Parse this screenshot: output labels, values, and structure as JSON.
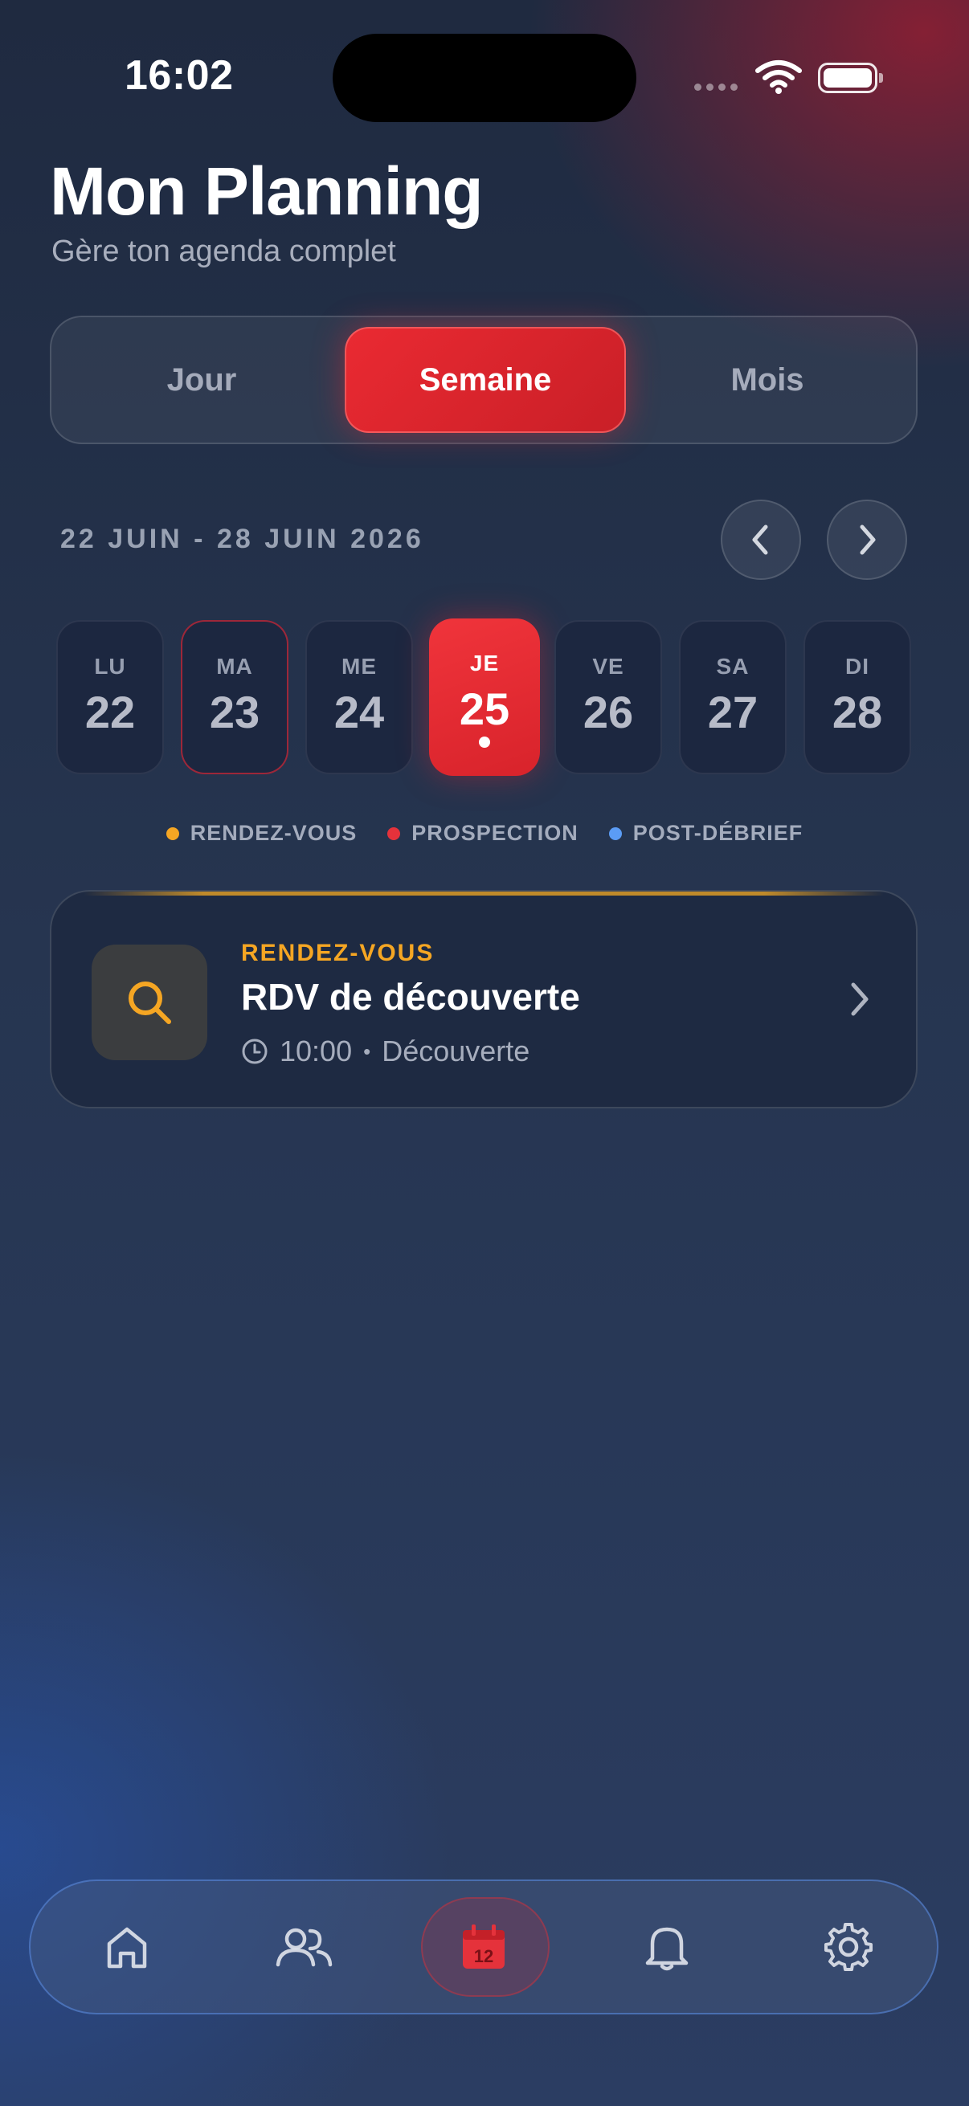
{
  "status_bar": {
    "time": "16:02"
  },
  "header": {
    "title": "Mon Planning",
    "subtitle": "Gère ton agenda complet"
  },
  "view_switch": {
    "options": [
      "Jour",
      "Semaine",
      "Mois"
    ],
    "selected": "Semaine"
  },
  "week": {
    "range_label": "22 JUIN - 28 JUIN 2026",
    "days": [
      {
        "name": "LU",
        "date": "22"
      },
      {
        "name": "MA",
        "date": "23"
      },
      {
        "name": "ME",
        "date": "24"
      },
      {
        "name": "JE",
        "date": "25"
      },
      {
        "name": "VE",
        "date": "26"
      },
      {
        "name": "SA",
        "date": "27"
      },
      {
        "name": "DI",
        "date": "28"
      }
    ],
    "selected_date": "25",
    "highlighted_date": "23"
  },
  "legend": [
    {
      "label": "RENDEZ-VOUS",
      "color": "#f5a623"
    },
    {
      "label": "PROSPECTION",
      "color": "#e5323b"
    },
    {
      "label": "POST-DÉBRIEF",
      "color": "#5b9cf5"
    }
  ],
  "events": [
    {
      "category": "RENDEZ-VOUS",
      "title": "RDV de découverte",
      "time": "10:00",
      "separator": "•",
      "type": "Découverte",
      "icon": "search-icon",
      "color": "#f5a623"
    }
  ],
  "tab_bar": {
    "items": [
      {
        "icon": "home-icon"
      },
      {
        "icon": "users-icon"
      },
      {
        "icon": "calendar-icon",
        "badge": "12",
        "active": true
      },
      {
        "icon": "bell-icon"
      },
      {
        "icon": "gear-icon"
      }
    ]
  },
  "colors": {
    "accent": "#e5323b",
    "rendezvous": "#f5a623",
    "debrief": "#5b9cf5"
  }
}
